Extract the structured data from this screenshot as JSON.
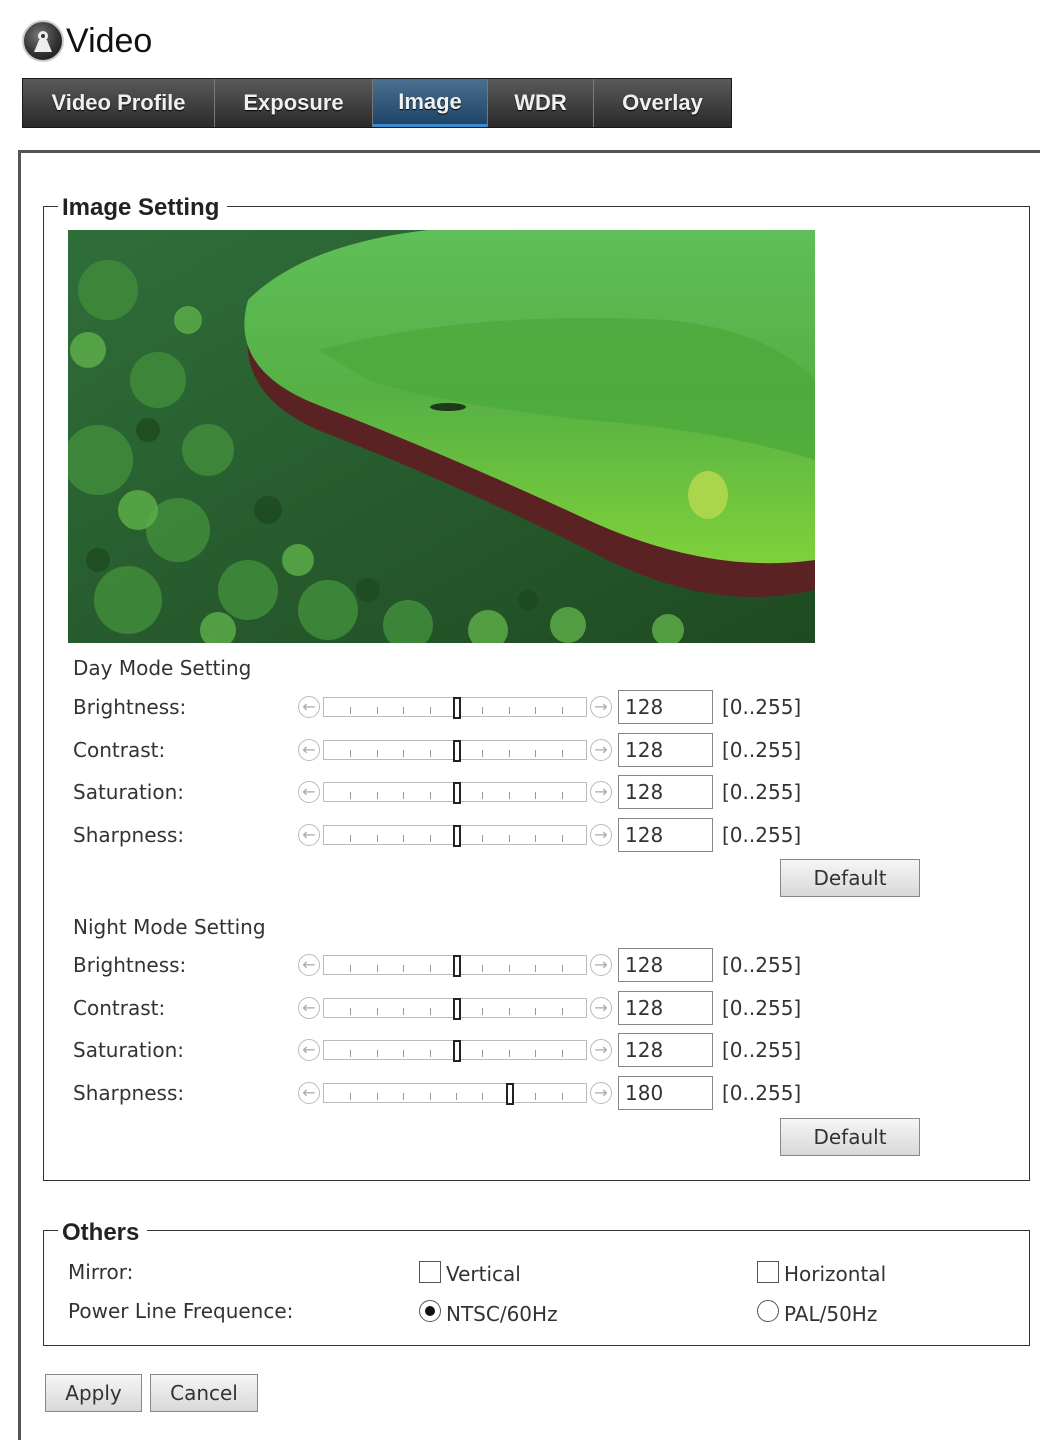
{
  "page": {
    "title": "Video"
  },
  "tabs": [
    {
      "label": "Video Profile",
      "active": false
    },
    {
      "label": "Exposure",
      "active": false
    },
    {
      "label": "Image",
      "active": true
    },
    {
      "label": "WDR",
      "active": false
    },
    {
      "label": "Overlay",
      "active": false
    }
  ],
  "image_setting": {
    "legend": "Image Setting",
    "day": {
      "title": "Day Mode Setting",
      "rows": [
        {
          "label": "Brightness:",
          "value": "128",
          "range": "[0..255]",
          "fraction": 0.502
        },
        {
          "label": "Contrast:",
          "value": "128",
          "range": "[0..255]",
          "fraction": 0.502
        },
        {
          "label": "Saturation:",
          "value": "128",
          "range": "[0..255]",
          "fraction": 0.502
        },
        {
          "label": "Sharpness:",
          "value": "128",
          "range": "[0..255]",
          "fraction": 0.502
        }
      ],
      "default_label": "Default"
    },
    "night": {
      "title": "Night Mode Setting",
      "rows": [
        {
          "label": "Brightness:",
          "value": "128",
          "range": "[0..255]",
          "fraction": 0.502
        },
        {
          "label": "Contrast:",
          "value": "128",
          "range": "[0..255]",
          "fraction": 0.502
        },
        {
          "label": "Saturation:",
          "value": "128",
          "range": "[0..255]",
          "fraction": 0.502
        },
        {
          "label": "Sharpness:",
          "value": "180",
          "range": "[0..255]",
          "fraction": 0.706
        }
      ],
      "default_label": "Default"
    }
  },
  "others": {
    "legend": "Others",
    "mirror_label": "Mirror:",
    "vertical_label": "Vertical",
    "vertical_checked": false,
    "horizontal_label": "Horizontal",
    "horizontal_checked": false,
    "power_label": "Power Line Frequence:",
    "ntsc_label": "NTSC/60Hz",
    "ntsc_selected": true,
    "pal_label": "PAL/50Hz",
    "pal_selected": false
  },
  "actions": {
    "apply_label": "Apply",
    "cancel_label": "Cancel"
  },
  "colors": {
    "tab_active": "#1f4466",
    "tab_bar": "#2a2a2a"
  }
}
